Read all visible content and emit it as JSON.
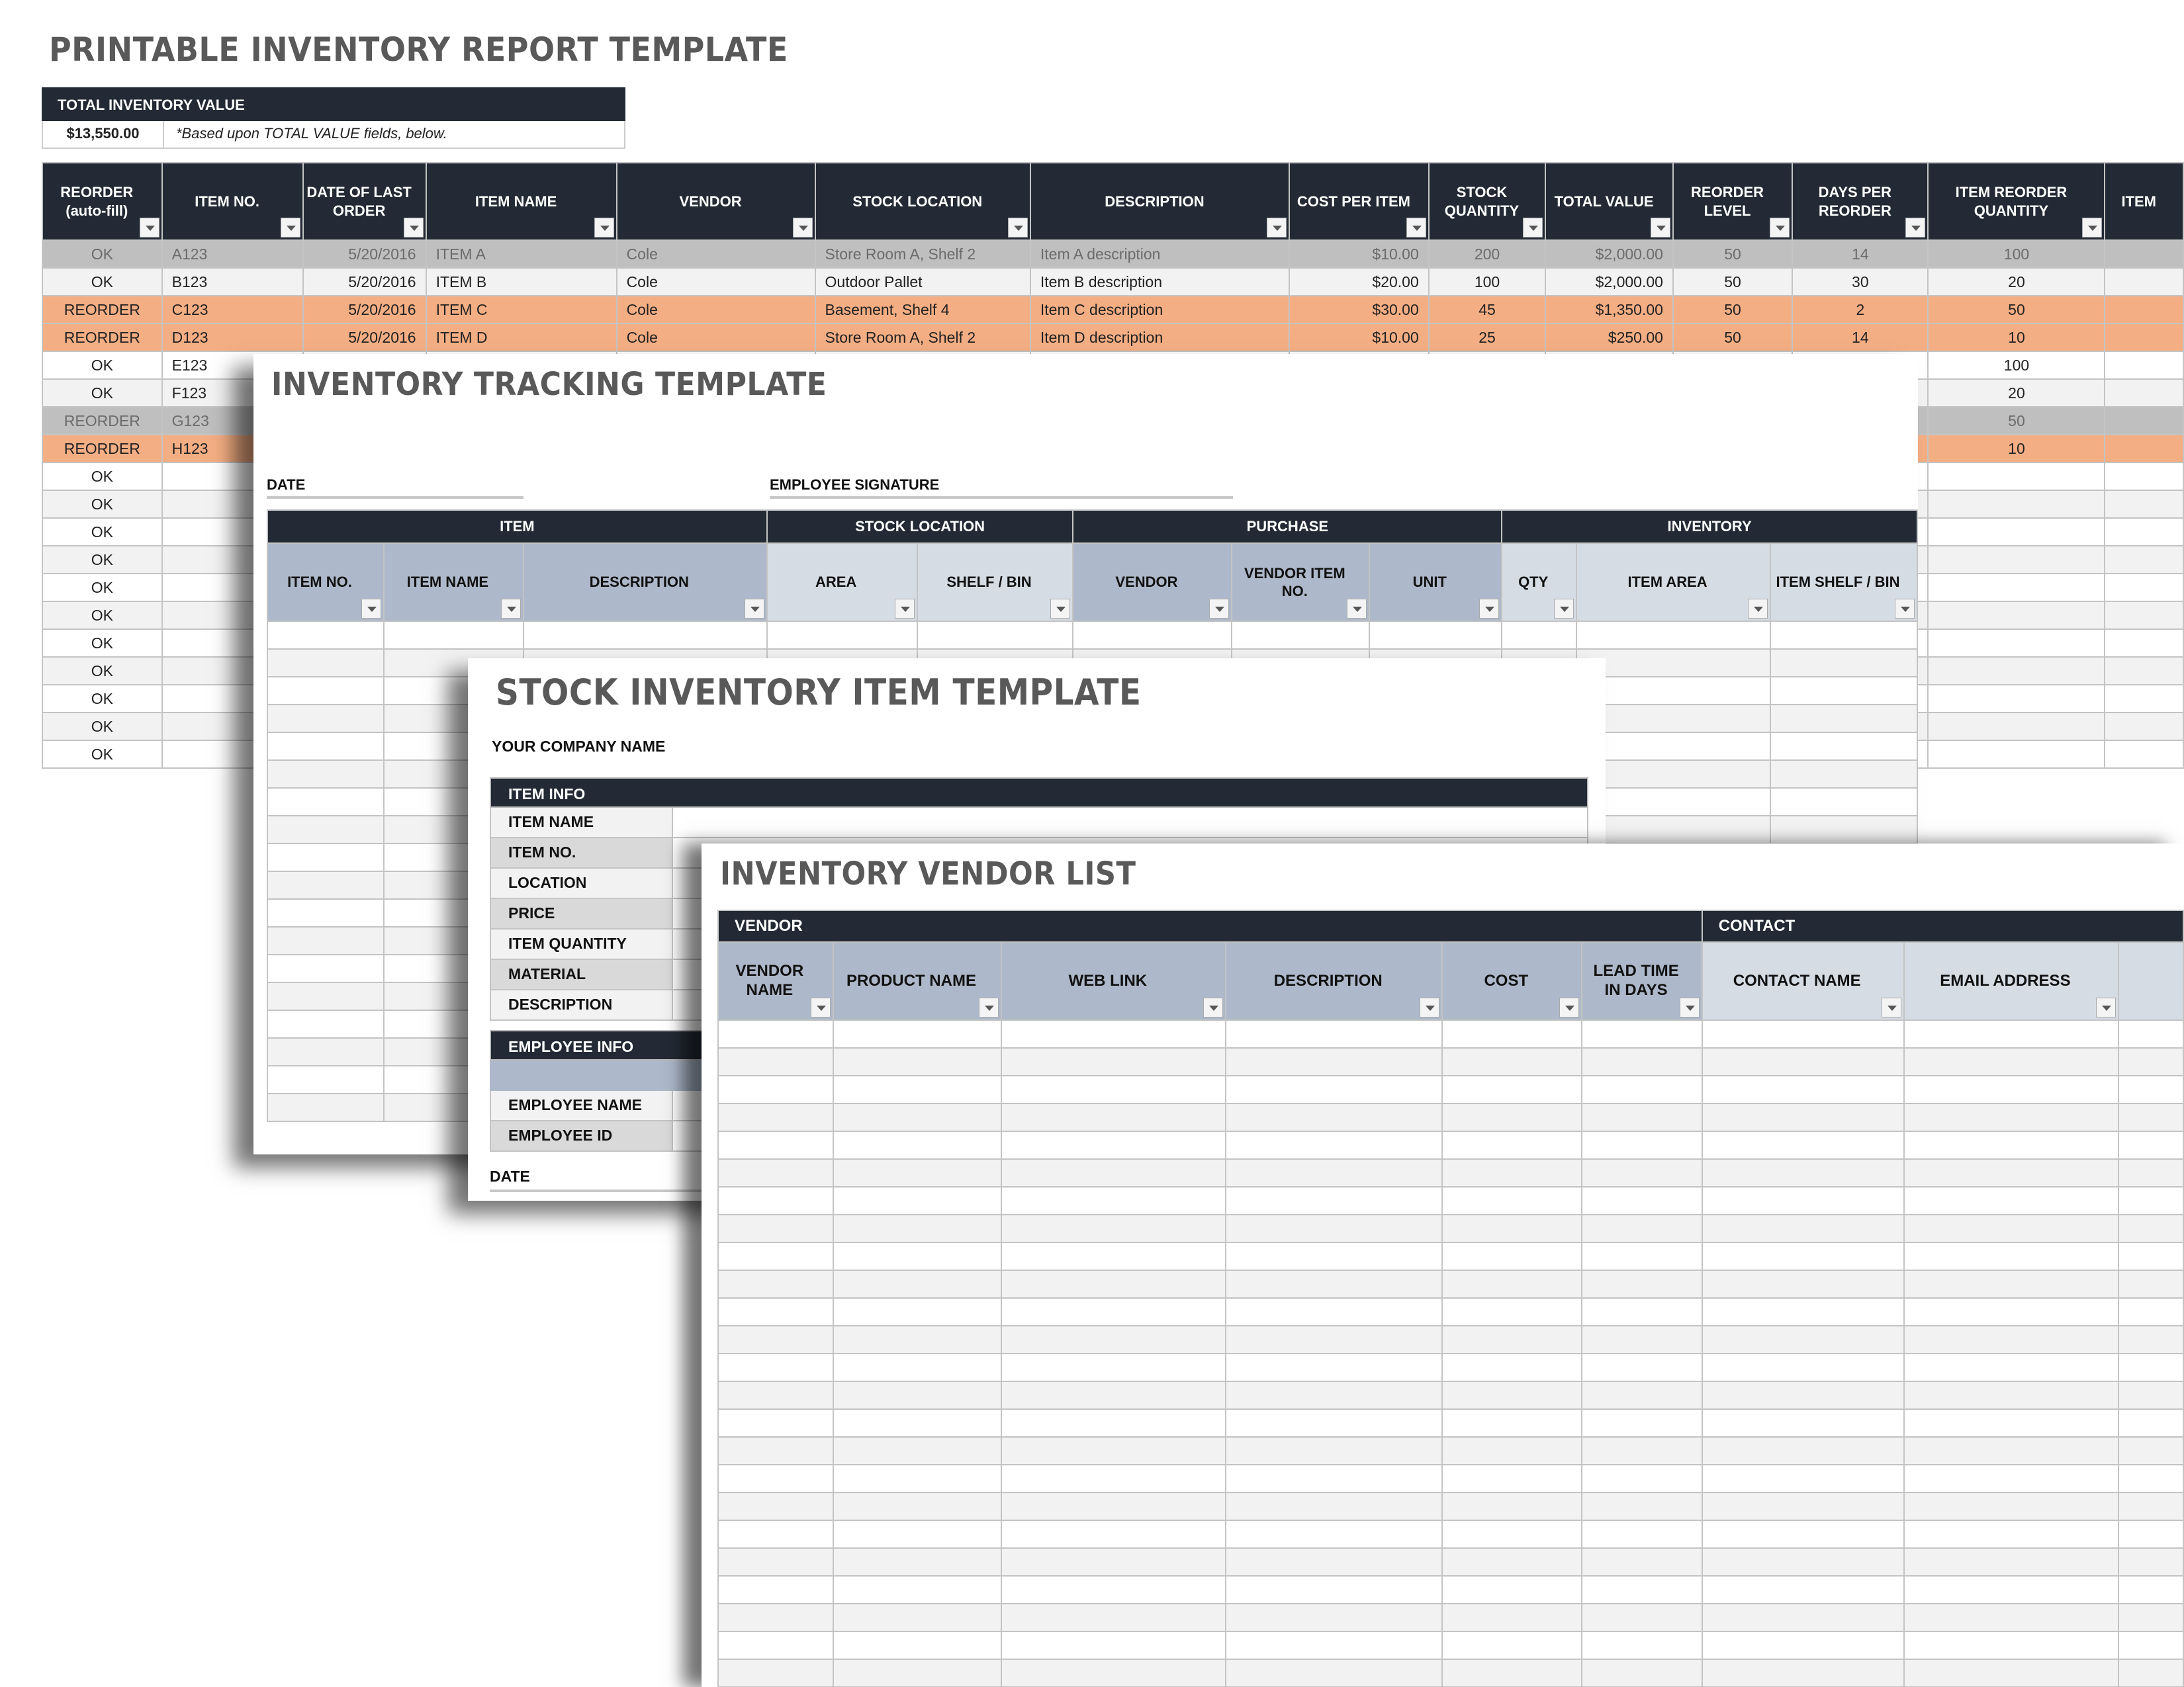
{
  "report": {
    "title": "PRINTABLE INVENTORY REPORT TEMPLATE",
    "total_label": "TOTAL INVENTORY VALUE",
    "total_value": "$13,550.00",
    "total_note": "*Based upon TOTAL VALUE fields, below.",
    "columns": [
      "REORDER (auto-fill)",
      "ITEM NO.",
      "DATE OF LAST ORDER",
      "ITEM NAME",
      "VENDOR",
      "STOCK LOCATION",
      "DESCRIPTION",
      "COST PER ITEM",
      "STOCK QUANTITY",
      "TOTAL VALUE",
      "REORDER LEVEL",
      "DAYS PER REORDER",
      "ITEM REORDER QUANTITY",
      "ITEM"
    ],
    "rows": [
      {
        "style": "grey",
        "cells": [
          "OK",
          "A123",
          "5/20/2016",
          "ITEM A",
          "Cole",
          "Store Room A, Shelf 2",
          "Item A description",
          "$10.00",
          "200",
          "$2,000.00",
          "50",
          "14",
          "100",
          ""
        ]
      },
      {
        "style": "light",
        "cells": [
          "OK",
          "B123",
          "5/20/2016",
          "ITEM B",
          "Cole",
          "Outdoor Pallet",
          "Item B description",
          "$20.00",
          "100",
          "$2,000.00",
          "50",
          "30",
          "20",
          ""
        ]
      },
      {
        "style": "orange",
        "cells": [
          "REORDER",
          "C123",
          "5/20/2016",
          "ITEM C",
          "Cole",
          "Basement, Shelf 4",
          "Item C description",
          "$30.00",
          "45",
          "$1,350.00",
          "50",
          "2",
          "50",
          ""
        ]
      },
      {
        "style": "orange",
        "cells": [
          "REORDER",
          "D123",
          "5/20/2016",
          "ITEM D",
          "Cole",
          "Store Room A, Shelf 2",
          "Item D description",
          "$10.00",
          "25",
          "$250.00",
          "50",
          "14",
          "10",
          ""
        ]
      },
      {
        "style": "white",
        "cells": [
          "OK",
          "E123",
          "",
          "",
          "",
          "",
          "",
          "",
          "",
          "",
          "",
          "",
          "100",
          ""
        ]
      },
      {
        "style": "light",
        "cells": [
          "OK",
          "F123",
          "",
          "",
          "",
          "",
          "",
          "",
          "",
          "",
          "",
          "",
          "20",
          ""
        ]
      },
      {
        "style": "grey",
        "cells": [
          "REORDER",
          "G123",
          "",
          "",
          "",
          "",
          "",
          "",
          "",
          "",
          "",
          "",
          "50",
          ""
        ]
      },
      {
        "style": "orange",
        "cells": [
          "REORDER",
          "H123",
          "",
          "",
          "",
          "",
          "",
          "",
          "",
          "",
          "",
          "",
          "10",
          ""
        ]
      },
      {
        "style": "white",
        "cells": [
          "OK",
          "",
          "",
          "",
          "",
          "",
          "",
          "",
          "",
          "",
          "",
          "",
          "",
          ""
        ]
      },
      {
        "style": "light",
        "cells": [
          "OK",
          "",
          "",
          "",
          "",
          "",
          "",
          "",
          "",
          "",
          "",
          "",
          "",
          ""
        ]
      },
      {
        "style": "white",
        "cells": [
          "OK",
          "",
          "",
          "",
          "",
          "",
          "",
          "",
          "",
          "",
          "",
          "",
          "",
          ""
        ]
      },
      {
        "style": "light",
        "cells": [
          "OK",
          "",
          "",
          "",
          "",
          "",
          "",
          "",
          "",
          "",
          "",
          "",
          "",
          ""
        ]
      },
      {
        "style": "white",
        "cells": [
          "OK",
          "",
          "",
          "",
          "",
          "",
          "",
          "",
          "",
          "",
          "",
          "",
          "",
          ""
        ]
      },
      {
        "style": "light",
        "cells": [
          "OK",
          "",
          "",
          "",
          "",
          "",
          "",
          "",
          "",
          "",
          "",
          "",
          "",
          ""
        ]
      },
      {
        "style": "white",
        "cells": [
          "OK",
          "",
          "",
          "",
          "",
          "",
          "",
          "",
          "",
          "",
          "",
          "",
          "",
          ""
        ]
      },
      {
        "style": "light",
        "cells": [
          "OK",
          "",
          "",
          "",
          "",
          "",
          "",
          "",
          "",
          "",
          "",
          "",
          "",
          ""
        ]
      },
      {
        "style": "white",
        "cells": [
          "OK",
          "",
          "",
          "",
          "",
          "",
          "",
          "",
          "",
          "",
          "",
          "",
          "",
          ""
        ]
      },
      {
        "style": "light",
        "cells": [
          "OK",
          "",
          "",
          "",
          "",
          "",
          "",
          "",
          "",
          "",
          "",
          "",
          "",
          ""
        ]
      },
      {
        "style": "white",
        "cells": [
          "OK",
          "",
          "",
          "",
          "",
          "",
          "",
          "",
          "",
          "",
          "",
          "",
          "",
          ""
        ]
      }
    ]
  },
  "tracking": {
    "title": "INVENTORY TRACKING TEMPLATE",
    "date_label": "DATE",
    "signature_label": "EMPLOYEE SIGNATURE",
    "groups": [
      {
        "label": "ITEM",
        "span": 3
      },
      {
        "label": "STOCK LOCATION",
        "span": 2
      },
      {
        "label": "PURCHASE",
        "span": 3
      },
      {
        "label": "INVENTORY",
        "span": 3
      }
    ],
    "columns": [
      {
        "label": "ITEM NO.",
        "tone": "blue"
      },
      {
        "label": "ITEM NAME",
        "tone": "blue"
      },
      {
        "label": "DESCRIPTION",
        "tone": "blue"
      },
      {
        "label": "AREA",
        "tone": "lite"
      },
      {
        "label": "SHELF / BIN",
        "tone": "lite"
      },
      {
        "label": "VENDOR",
        "tone": "blue"
      },
      {
        "label": "VENDOR ITEM NO.",
        "tone": "blue"
      },
      {
        "label": "UNIT",
        "tone": "blue"
      },
      {
        "label": "QTY",
        "tone": "lite"
      },
      {
        "label": "ITEM AREA",
        "tone": "lite"
      },
      {
        "label": "ITEM SHELF / BIN",
        "tone": "lite"
      }
    ],
    "empty_rows": 18
  },
  "stock_item": {
    "title": "STOCK INVENTORY ITEM TEMPLATE",
    "company_label": "YOUR COMPANY NAME",
    "item_info_label": "ITEM INFO",
    "item_fields": [
      "ITEM NAME",
      "ITEM NO.",
      "LOCATION",
      "PRICE",
      "ITEM QUANTITY",
      "MATERIAL",
      "DESCRIPTION"
    ],
    "employee_info_label": "EMPLOYEE INFO",
    "employee_fields": [
      "EMPLOYEE NAME",
      "EMPLOYEE ID"
    ],
    "date_label": "DATE"
  },
  "vendor_list": {
    "title": "INVENTORY VENDOR LIST",
    "groups": [
      {
        "label": "VENDOR",
        "span": 6
      },
      {
        "label": "CONTACT",
        "span": 3
      }
    ],
    "columns": [
      {
        "label": "VENDOR NAME",
        "tone": "blue"
      },
      {
        "label": "PRODUCT NAME",
        "tone": "blue"
      },
      {
        "label": "WEB LINK",
        "tone": "blue"
      },
      {
        "label": "DESCRIPTION",
        "tone": "blue"
      },
      {
        "label": "COST",
        "tone": "blue"
      },
      {
        "label": "LEAD TIME IN DAYS",
        "tone": "blue"
      },
      {
        "label": "CONTACT NAME",
        "tone": "lite"
      },
      {
        "label": "EMAIL ADDRESS",
        "tone": "lite"
      },
      {
        "label": "",
        "tone": "lite"
      }
    ],
    "empty_rows": 24
  }
}
